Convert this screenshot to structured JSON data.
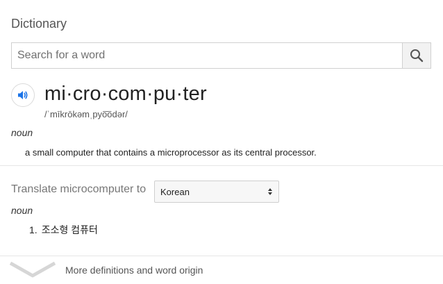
{
  "title": "Dictionary",
  "search": {
    "placeholder": "Search for a word",
    "value": "",
    "icon": "search-icon"
  },
  "entry": {
    "word": "mi·cro·com·pu·ter",
    "pronunciation": "/ˈmīkrōkəmˌpyo͞odər/",
    "part_of_speech": "noun",
    "definition": "a small computer that contains a microprocessor as its central processor."
  },
  "translate": {
    "label": "Translate microcomputer to",
    "language": "Korean",
    "part_of_speech": "noun",
    "items": [
      {
        "number": "1.",
        "text": "조소형 컴퓨터"
      }
    ]
  },
  "more": {
    "label": "More definitions and word origin"
  },
  "colors": {
    "accent": "#1a73e8",
    "muted": "#777777",
    "border": "#d0d0d0"
  }
}
